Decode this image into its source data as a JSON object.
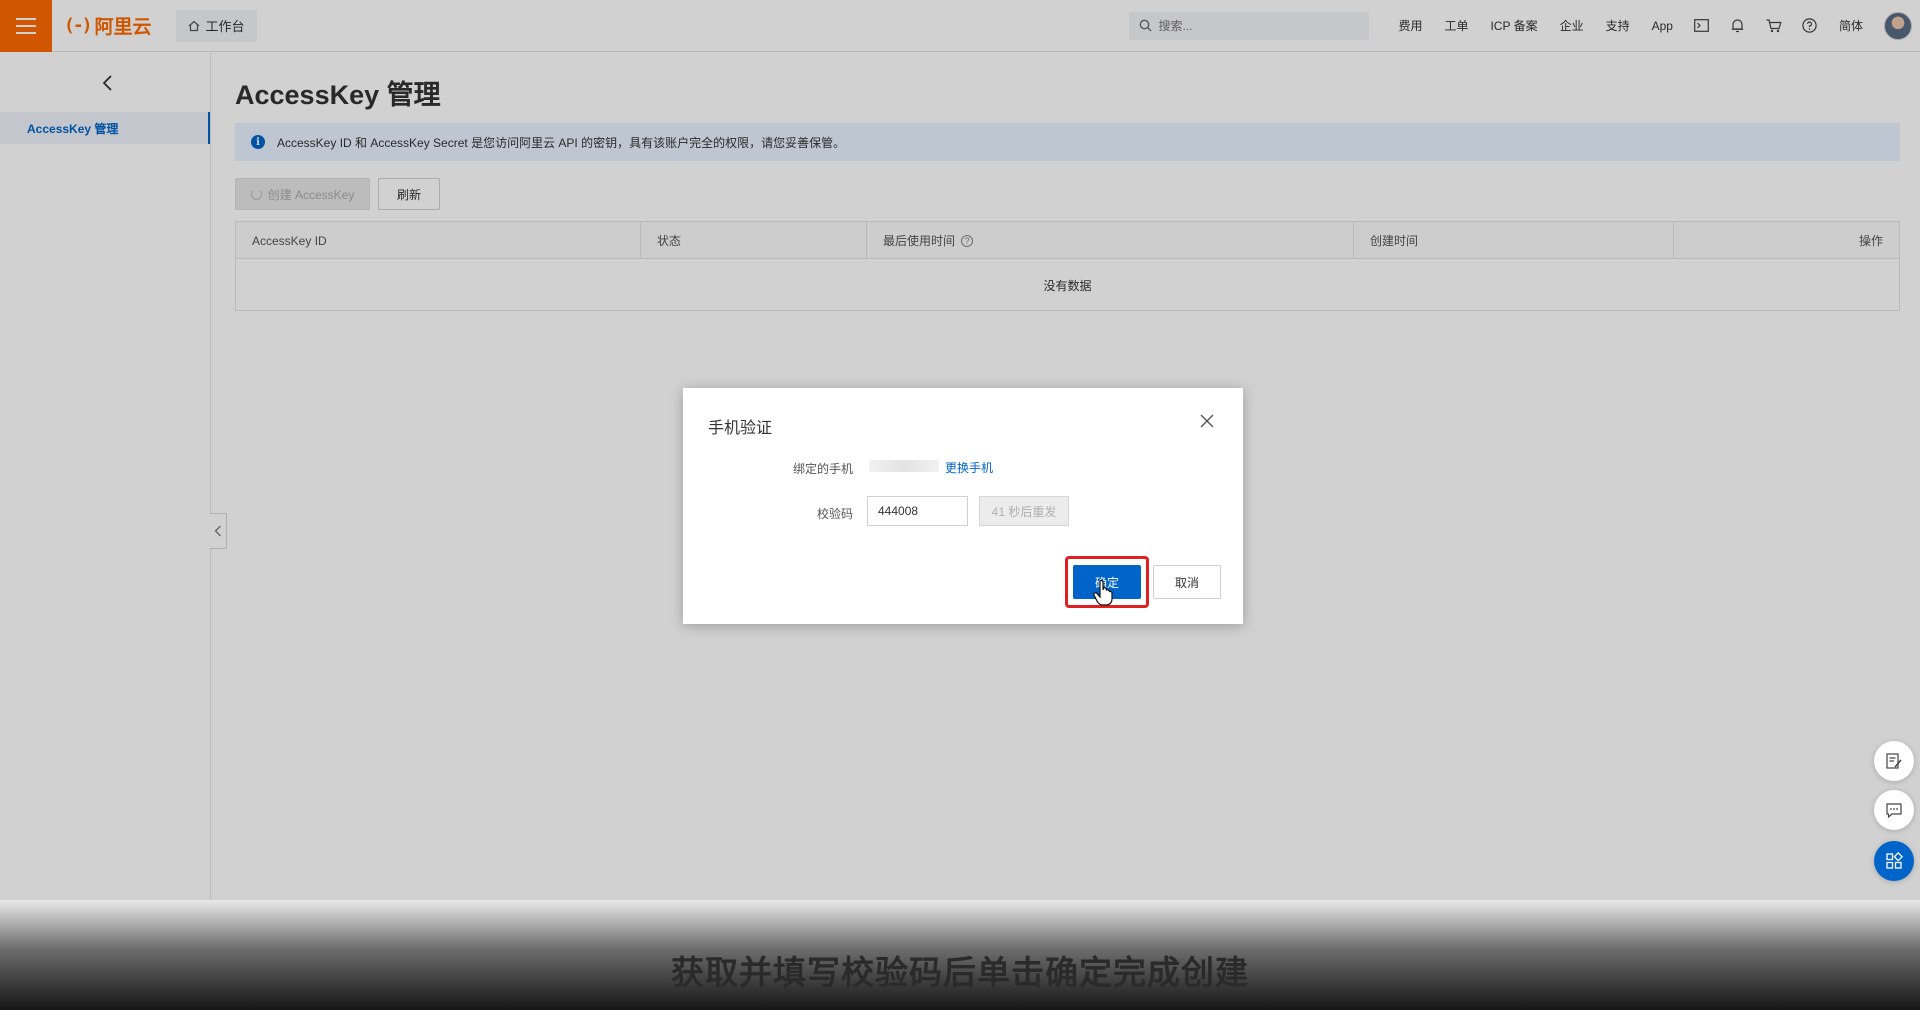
{
  "topbar": {
    "logo_text": "阿里云",
    "workbench_label": "工作台",
    "search_placeholder": "搜索...",
    "nav": [
      "费用",
      "工单",
      "ICP 备案",
      "企业",
      "支持",
      "App"
    ],
    "language": "简体",
    "brand_color": "#ff6a00"
  },
  "sidebar": {
    "items": [
      {
        "label": "AccessKey 管理",
        "active": true
      }
    ]
  },
  "main": {
    "title": "AccessKey 管理",
    "alert": "AccessKey ID 和 AccessKey Secret 是您访问阿里云 API 的密钥，具有该账户完全的权限，请您妥善保管。",
    "create_button": "创建 AccessKey",
    "refresh_button": "刷新",
    "table": {
      "columns": [
        "AccessKey ID",
        "状态",
        "最后使用时间",
        "创建时间",
        "操作"
      ],
      "empty_text": "没有数据"
    }
  },
  "dialog": {
    "title": "手机验证",
    "phone_label": "绑定的手机",
    "change_phone": "更换手机",
    "code_label": "校验码",
    "code_value": "444008",
    "resend_label": "41 秒后重发",
    "confirm_button": "确定",
    "cancel_button": "取消",
    "primary_color": "#0064c8",
    "highlight_color": "#e02020"
  },
  "caption": {
    "text": "获取并填写校验码后单击确定完成创建"
  }
}
